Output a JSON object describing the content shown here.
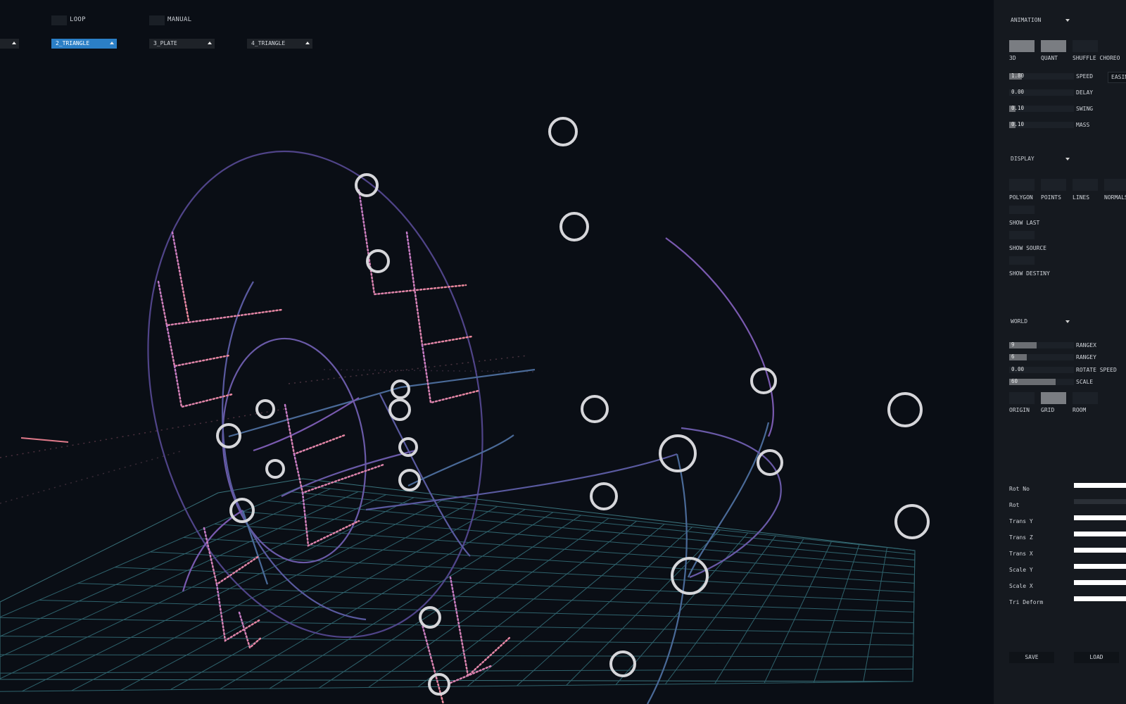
{
  "toolbar": {
    "loop_label": "LOOP",
    "manual_label": "MANUAL",
    "dropdowns": [
      {
        "label": "",
        "selected": false
      },
      {
        "label": "2_TRIANGLE",
        "selected": true
      },
      {
        "label": "3_PLATE",
        "selected": false
      },
      {
        "label": "4_TRIANGLE",
        "selected": false
      }
    ]
  },
  "panel": {
    "animation": {
      "header": "ANIMATION",
      "toggles": [
        {
          "label": "3D",
          "on": true
        },
        {
          "label": "QUANT",
          "on": true
        },
        {
          "label": "SHUFFLE CHOREO",
          "on": false
        }
      ],
      "easing_label": "EASIN",
      "sliders": [
        {
          "value": "1.80",
          "label": "SPEED",
          "fill": 0.2
        },
        {
          "value": "0.00",
          "label": "DELAY",
          "fill": 0
        },
        {
          "value": "0.10",
          "label": "SWING",
          "fill": 0.1
        },
        {
          "value": "0.10",
          "label": "MASS",
          "fill": 0.1
        }
      ]
    },
    "display": {
      "header": "DISPLAY",
      "toggles": [
        {
          "label": "POLYGON",
          "on": false
        },
        {
          "label": "POINTS",
          "on": false
        },
        {
          "label": "LINES",
          "on": false
        },
        {
          "label": "NORMALS",
          "on": false
        }
      ],
      "options": [
        {
          "label": "SHOW LAST",
          "on": false
        },
        {
          "label": "SHOW SOURCE",
          "on": false
        },
        {
          "label": "SHOW DESTINY",
          "on": false
        }
      ]
    },
    "world": {
      "header": "WORLD",
      "sliders": [
        {
          "value": "9",
          "label": "RANGEX",
          "fill": 0.42
        },
        {
          "value": "6",
          "label": "RANGEY",
          "fill": 0.27
        },
        {
          "value": "0.00",
          "label": "ROTATE SPEED",
          "fill": 0
        },
        {
          "value": "60",
          "label": "SCALE",
          "fill": 0.72
        }
      ],
      "toggles": [
        {
          "label": "ORIGIN",
          "on": false
        },
        {
          "label": "GRID",
          "on": true
        },
        {
          "label": "ROOM",
          "on": false
        }
      ]
    },
    "params": [
      {
        "label": "Rot No",
        "dim": false
      },
      {
        "label": "Rot",
        "dim": true
      },
      {
        "label": "Trans Y",
        "dim": false
      },
      {
        "label": "Trans Z",
        "dim": false
      },
      {
        "label": "Trans X",
        "dim": false
      },
      {
        "label": "Scale Y",
        "dim": false
      },
      {
        "label": "Scale X",
        "dim": false
      },
      {
        "label": "Tri Deform",
        "dim": false
      }
    ],
    "save_label": "SAVE",
    "load_label": "LOAD"
  },
  "colors": {
    "background": "#0a0e15",
    "panel": "#15191f",
    "grid": "#3e8590",
    "curve_purple": "#6a5aa8",
    "curve_blue": "#4a6a98",
    "dots_pink": "#e07aa0",
    "node_ring": "#d8d8dc",
    "accent_blue": "#2b7fc6"
  }
}
